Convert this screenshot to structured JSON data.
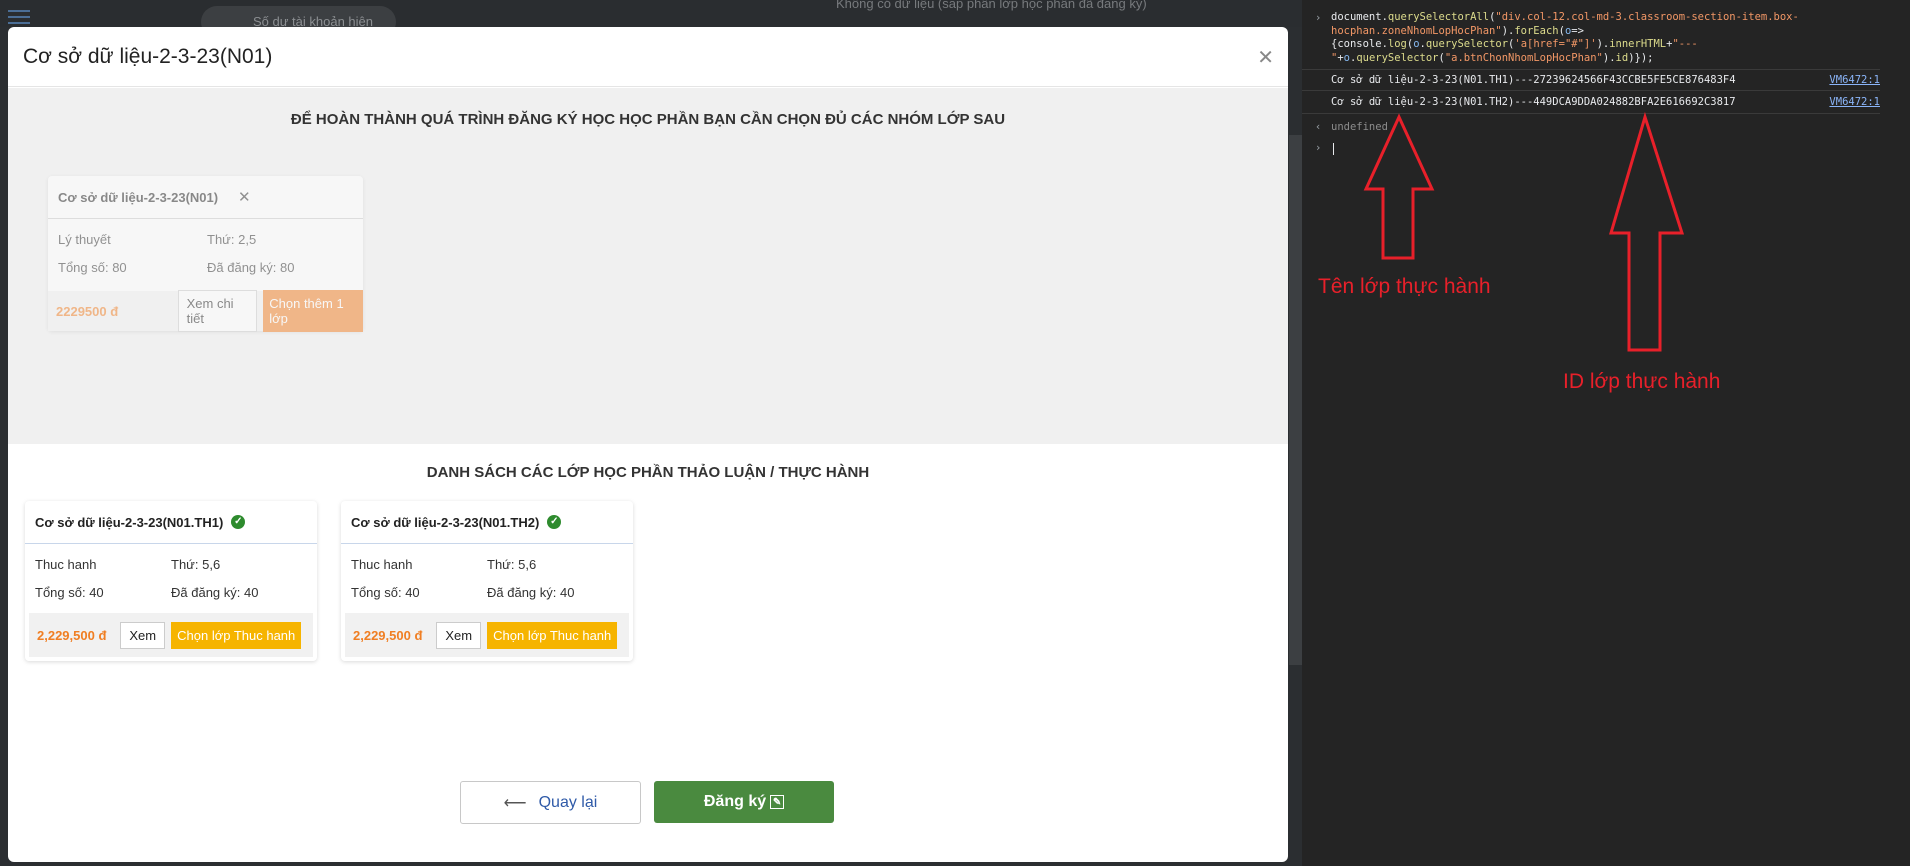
{
  "background": {
    "pill_text": "Số dư tài khoản hiện",
    "top_text": "Không có dữ liệu (sắp phân lớp học phần đã đăng ký)"
  },
  "modal": {
    "title": "Cơ sở dữ liệu-2-3-23(N01)",
    "required_heading": "ĐỂ HOÀN THÀNH QUÁ TRÌNH ĐĂNG KÝ HỌC HỌC PHẦN BẠN CẦN CHỌN ĐỦ CÁC NHÓM LỚP SAU",
    "selected_card": {
      "title": "Cơ sở dữ liệu-2-3-23(N01)",
      "type": "Lý thuyết",
      "day": "Thứ: 2,5",
      "total": "Tổng số: 80",
      "registered": "Đã đăng ký: 80",
      "price": "2229500 đ",
      "detail_btn": "Xem chi tiết",
      "add_btn": "Chọn thêm 1 lớp"
    },
    "list_heading": "DANH SÁCH CÁC LỚP HỌC PHẦN THẢO LUẬN / THỰC HÀNH",
    "practice_cards": [
      {
        "title": "Cơ sở dữ liệu-2-3-23(N01.TH1)",
        "type": "Thuc hanh",
        "day": "Thứ: 5,6",
        "total": "Tổng số: 40",
        "registered": "Đã đăng ký: 40",
        "price": "2,229,500 đ",
        "view_btn": "Xem",
        "choose_btn": "Chọn lớp Thuc hanh"
      },
      {
        "title": "Cơ sở dữ liệu-2-3-23(N01.TH2)",
        "type": "Thuc hanh",
        "day": "Thứ: 5,6",
        "total": "Tổng số: 40",
        "registered": "Đã đăng ký: 40",
        "price": "2,229,500 đ",
        "view_btn": "Xem",
        "choose_btn": "Chọn lớp Thuc hanh"
      }
    ],
    "back_btn": "Quay lại",
    "submit_btn": "Đăng ký"
  },
  "console": {
    "outputs": [
      {
        "text": "Cơ sở dữ liệu-2-3-23(N01.TH1)---27239624566F43CCBE5FE5CE876483F4",
        "source": "VM6472:1"
      },
      {
        "text": "Cơ sở dữ liệu-2-3-23(N01.TH2)---449DCA9DDA024882BFA2E616692C3817",
        "source": "VM6472:1"
      }
    ],
    "return_value": "undefined"
  },
  "annotations": {
    "class_name_label": "Tên lớp thực hành",
    "class_id_label": "ID lớp thực hành"
  },
  "colors": {
    "accent_green": "#4a8a3f",
    "price_orange": "#f07e22",
    "choose_yellow": "#f6b400",
    "annotation_red": "#e8202a"
  }
}
